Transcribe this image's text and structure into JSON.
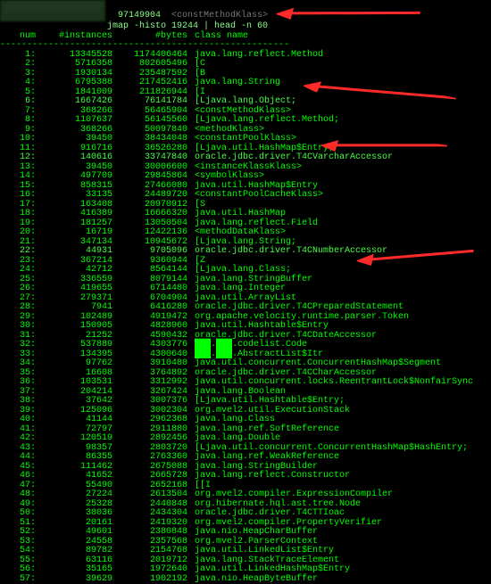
{
  "header": {
    "redacted_prefix": "█████████",
    "mem_addr": "97149904",
    "klass_tag": "<constMethodKlass>",
    "cmd": "jmap -histo 19244 | head -n 60"
  },
  "columns": {
    "num": "num",
    "instances": "#instances",
    "bytes": "#bytes",
    "classname": "class name"
  },
  "dash_line": "------------------------------------------------------",
  "rows": [
    {
      "n": "1:",
      "i": "13345528",
      "b": "1174406464",
      "c": "java.lang.reflect.Method"
    },
    {
      "n": "2:",
      "i": "5716358",
      "b": "802605496",
      "c": "[C"
    },
    {
      "n": "3:",
      "i": "1930134",
      "b": "235487592",
      "c": "[B"
    },
    {
      "n": "4:",
      "i": "6795388",
      "b": "217452416",
      "c": "java.lang.String"
    },
    {
      "n": "5:",
      "i": "1841009",
      "b": "211826944",
      "c": "[I"
    },
    {
      "n": "6:",
      "i": "1667426",
      "b": "76141784",
      "c": "[Ljava.lang.Object;",
      "hl": true
    },
    {
      "n": "7:",
      "i": "368266",
      "b": "56465904",
      "c": "<constMethodKlass>"
    },
    {
      "n": "8:",
      "i": "1107637",
      "b": "56145560",
      "c": "[Ljava.lang.reflect.Method;"
    },
    {
      "n": "9:",
      "i": "368266",
      "b": "50097840",
      "c": "<methodKlass>"
    },
    {
      "n": "10:",
      "i": "39450",
      "b": "38434048",
      "c": "<constantPoolKlass>"
    },
    {
      "n": "11:",
      "i": "916716",
      "b": "36526280",
      "c": "[Ljava.util.HashMap$Entry;"
    },
    {
      "n": "12:",
      "i": "140616",
      "b": "33747840",
      "c": "oracle.jdbc.driver.T4CVarcharAccessor",
      "hl": true
    },
    {
      "n": "13:",
      "i": "39450",
      "b": "30006600",
      "c": "<instanceKlassKlass>"
    },
    {
      "n": "14:",
      "i": "497709",
      "b": "29845864",
      "c": "<symbolKlass>"
    },
    {
      "n": "15:",
      "i": "858315",
      "b": "27466080",
      "c": "java.util.HashMap$Entry"
    },
    {
      "n": "16:",
      "i": "33135",
      "b": "24489720",
      "c": "<constantPoolCacheKlass>"
    },
    {
      "n": "17:",
      "i": "163408",
      "b": "20970912",
      "c": "[S"
    },
    {
      "n": "18:",
      "i": "416389",
      "b": "16666320",
      "c": "java.util.HashMap"
    },
    {
      "n": "19:",
      "i": "181257",
      "b": "13050504",
      "c": "java.lang.reflect.Field"
    },
    {
      "n": "20:",
      "i": "16719",
      "b": "12422136",
      "c": "<methodDataKlass>"
    },
    {
      "n": "21:",
      "i": "347134",
      "b": "10945672",
      "c": "[Ljava.lang.String;"
    },
    {
      "n": "22:",
      "i": "44931",
      "b": "9705096",
      "c": "oracle.jdbc.driver.T4CNumberAccessor",
      "hl": true
    },
    {
      "n": "23:",
      "i": "367214",
      "b": "9360944",
      "c": "[Z"
    },
    {
      "n": "24:",
      "i": "42712",
      "b": "8564144",
      "c": "[Ljava.lang.Class;"
    },
    {
      "n": "25:",
      "i": "336559",
      "b": "8079144",
      "c": "java.lang.StringBuffer"
    },
    {
      "n": "26:",
      "i": "419655",
      "b": "6714480",
      "c": "java.lang.Integer"
    },
    {
      "n": "27:",
      "i": "279371",
      "b": "6704904",
      "c": "java.util.ArrayList"
    },
    {
      "n": "28:",
      "i": "7941",
      "b": "6416280",
      "c": "oracle.jdbc.driver.T4CPreparedStatement"
    },
    {
      "n": "29:",
      "i": "102489",
      "b": "4919472",
      "c": "org.apache.velocity.runtime.parser.Token"
    },
    {
      "n": "30:",
      "i": "150905",
      "b": "4828960",
      "c": "java.util.Hashtable$Entry"
    },
    {
      "n": "31:",
      "i": "21252",
      "b": "4590432",
      "c": "oracle.jdbc.driver.T4CDateAccessor"
    },
    {
      "n": "32:",
      "i": "537889",
      "b": "4303776",
      "c": "███.███.codelist.Code"
    },
    {
      "n": "33:",
      "i": "134395",
      "b": "4300640",
      "c": "███.███.AbstractList$Itr"
    },
    {
      "n": "34:",
      "i": "97762",
      "b": "3910480",
      "c": "java.util.concurrent.ConcurrentHashMap$Segment"
    },
    {
      "n": "35:",
      "i": "16608",
      "b": "3764892",
      "c": "oracle.jdbc.driver.T4CCharAccessor"
    },
    {
      "n": "36:",
      "i": "103531",
      "b": "3312992",
      "c": "java.util.concurrent.locks.ReentrantLock$NonfairSync"
    },
    {
      "n": "37:",
      "i": "204214",
      "b": "3267424",
      "c": "java.lang.Boolean"
    },
    {
      "n": "38:",
      "i": "37642",
      "b": "3007376",
      "c": "[Ljava.util.Hashtable$Entry;"
    },
    {
      "n": "39:",
      "i": "125096",
      "b": "3002304",
      "c": "org.mvel2.util.ExecutionStack"
    },
    {
      "n": "40:",
      "i": "41144",
      "b": "2962368",
      "c": "java.lang.Class"
    },
    {
      "n": "41:",
      "i": "72797",
      "b": "2911880",
      "c": "java.lang.ref.SoftReference"
    },
    {
      "n": "42:",
      "i": "120519",
      "b": "2892456",
      "c": "java.lang.Double"
    },
    {
      "n": "43:",
      "i": "98357",
      "b": "2803720",
      "c": "[Ljava.util.concurrent.ConcurrentHashMap$HashEntry;"
    },
    {
      "n": "44:",
      "i": "86355",
      "b": "2763360",
      "c": "java.lang.ref.WeakReference"
    },
    {
      "n": "45:",
      "i": "111462",
      "b": "2675088",
      "c": "java.lang.StringBuilder"
    },
    {
      "n": "46:",
      "i": "41652",
      "b": "2665728",
      "c": "java.lang.reflect.Constructor"
    },
    {
      "n": "47:",
      "i": "55490",
      "b": "2652168",
      "c": "[[I"
    },
    {
      "n": "48:",
      "i": "27224",
      "b": "2613504",
      "c": "org.mvel2.compiler.ExpressionCompiler"
    },
    {
      "n": "49:",
      "i": "25328",
      "b": "2440848",
      "c": "org.hibernate.hql.ast.tree.Node"
    },
    {
      "n": "50:",
      "i": "38036",
      "b": "2434304",
      "c": "oracle.jdbc.driver.T4CTTIoac"
    },
    {
      "n": "51:",
      "i": "20161",
      "b": "2419320",
      "c": "org.mvel2.compiler.PropertyVerifier"
    },
    {
      "n": "52:",
      "i": "49601",
      "b": "2380848",
      "c": "java.nio.HeapCharBuffer"
    },
    {
      "n": "53:",
      "i": "24558",
      "b": "2357568",
      "c": "org.mvel2.ParserContext"
    },
    {
      "n": "54:",
      "i": "89782",
      "b": "2154768",
      "c": "java.util.LinkedList$Entry"
    },
    {
      "n": "55:",
      "i": "63116",
      "b": "2019712",
      "c": "java.lang.StackTraceElement"
    },
    {
      "n": "56:",
      "i": "35165",
      "b": "1972640",
      "c": "java.util.LinkedHashMap$Entry"
    },
    {
      "n": "57:",
      "i": "39629",
      "b": "1902192",
      "c": "java.nio.HeapByteBuffer"
    }
  ]
}
